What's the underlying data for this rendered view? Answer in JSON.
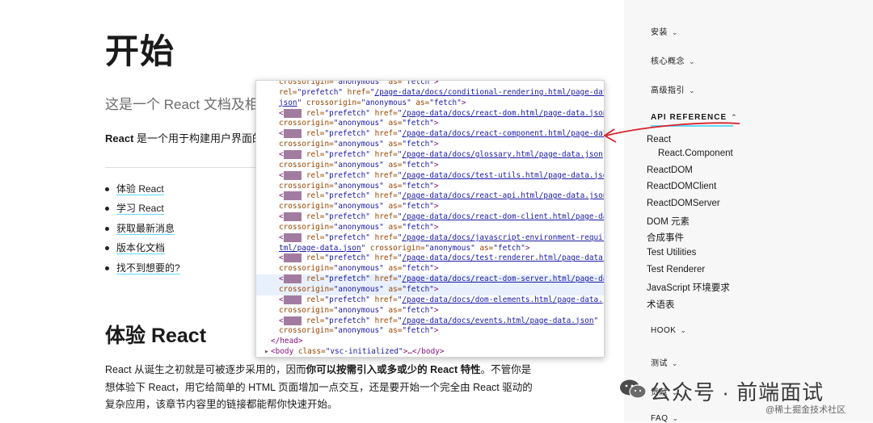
{
  "main": {
    "title": "开始",
    "intro": "这是一个 React 文档及相关",
    "desc": "React 是一个用于构建用户界面的 Ja",
    "links": [
      "体验 React",
      "学习 React",
      "获取最新消息",
      "版本化文档",
      "找不到想要的?"
    ],
    "section_title": "体验 React",
    "para": {
      "l1_a": "React 从诞生之初就是可被逐步采用的，因而",
      "l1_b": "你可以按需引入或多或少的 React 特性",
      "l1_c": "。不管你是",
      "l2": "想体验下 React，用它给简单的 HTML 页面增加一点交互，还是要开始一个完全由 React 驱动的",
      "l3": "复杂应用，该章节内容里的链接都能帮你快速开始。"
    }
  },
  "devtools": {
    "top_line": "crossorigin=\"anonymous\" as=\"fetch\">",
    "link_open": "<link",
    "rel": " rel=",
    "rel_val": "\"prefetch\"",
    "href": " href=",
    "cross": "crossorigin=",
    "cross_val": "\"anonymous\"",
    "as": " as=",
    "as_val": "\"fetch\"",
    "close": ">",
    "links": [
      {
        "url": "/page-data/docs/conditional-rendering.html/page-data.",
        "url2": "json"
      },
      {
        "url": "/page-data/docs/react-dom.html/page-data.json"
      },
      {
        "url": "/page-data/docs/react-component.html/page-data.json"
      },
      {
        "url": "/page-data/docs/glossary.html/page-data.json"
      },
      {
        "url": "/page-data/docs/test-utils.html/page-data.json"
      },
      {
        "url": "/page-data/docs/react-api.html/page-data.json"
      },
      {
        "url": "/page-data/docs/react-dom-client.html/page-data.json"
      },
      {
        "url": "/page-data/docs/javascript-environment-requirements.h",
        "url2": "tml/page-data.json"
      },
      {
        "url": "/page-data/docs/test-renderer.html/page-data.json"
      },
      {
        "url": "/page-data/docs/react-dom-server.html/page-data.json"
      },
      {
        "url": "/page-data/docs/dom-elements.html/page-data.json"
      },
      {
        "url": "/page-data/docs/events.html/page-data.json"
      }
    ],
    "head_close": "</head>",
    "body_open": "<body",
    "body_class": " class=",
    "body_class_val": "\"vsc-initialized\"",
    "body_rest": ">…</body>"
  },
  "sidebar": {
    "sections": [
      "安装",
      "核心概念",
      "高级指引",
      "API REFERENCE",
      "HOOK",
      "测试",
      "贡献",
      "FAQ"
    ],
    "api_items": [
      "React",
      "React.Component",
      "ReactDOM",
      "ReactDOMClient",
      "ReactDOMServer",
      "DOM 元素",
      "合成事件",
      "Test Utilities",
      "Test Renderer",
      "JavaScript 环境要求",
      "术语表"
    ]
  },
  "watermark": {
    "main": "公众号 · 前端面试",
    "sub": "@稀土掘金技术社区"
  },
  "colors": {
    "accent": "#61dafb",
    "annotation": "#d9232a"
  }
}
